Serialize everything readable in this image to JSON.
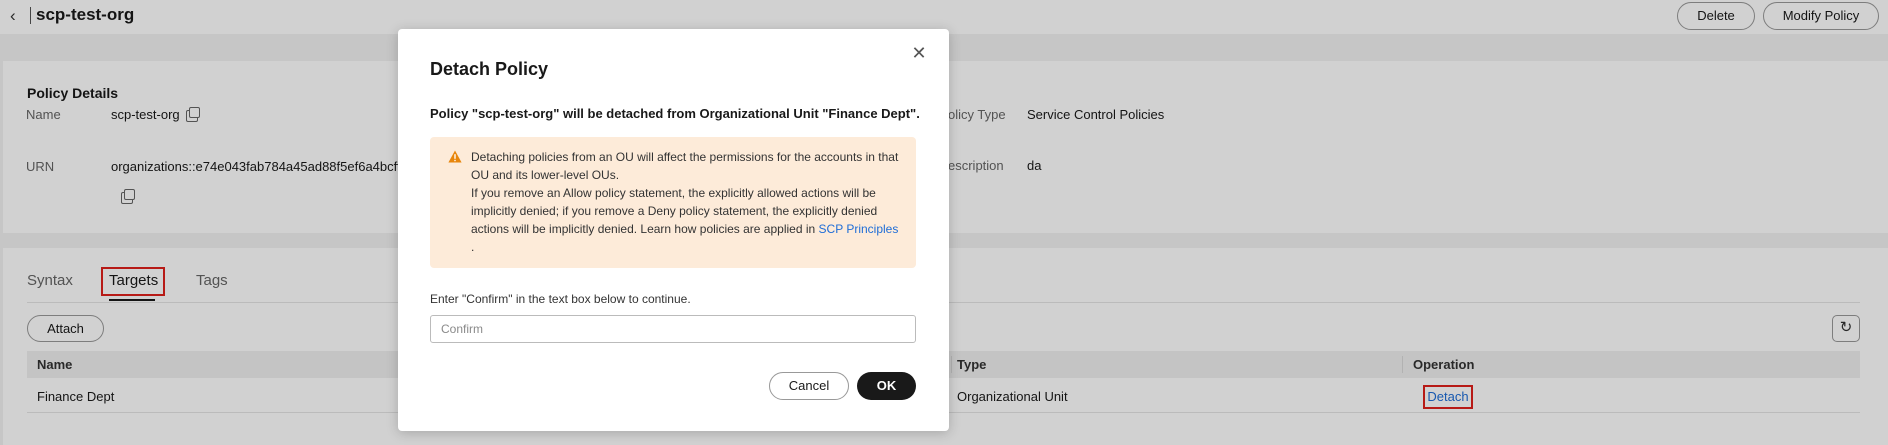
{
  "header": {
    "back_icon": "chevron-left-icon",
    "title": "scp-test-org",
    "delete_label": "Delete",
    "modify_label": "Modify Policy"
  },
  "policy_details": {
    "title": "Policy Details",
    "name_label": "Name",
    "name_value": "scp-test-org",
    "urn_label": "URN",
    "urn_value": "organizations::e74e043fab784a45ad88f5ef6a4bcffc:pc",
    "type_label": "olicy Type",
    "type_value": "Service Control Policies",
    "description_label": "escription",
    "description_value": "da"
  },
  "tabs": [
    {
      "label": "Syntax"
    },
    {
      "label": "Targets"
    },
    {
      "label": "Tags"
    }
  ],
  "targets": {
    "attach_label": "Attach",
    "refresh_icon": "refresh-icon",
    "columns": [
      "Name",
      "Type",
      "Operation"
    ],
    "rows": [
      {
        "name": "Finance Dept",
        "type": "Organizational Unit",
        "operation": "Detach"
      }
    ]
  },
  "modal": {
    "title": "Detach Policy",
    "message": "Policy \"scp-test-org\" will be detached from Organizational Unit \"Finance Dept\".",
    "warning_line1": "Detaching policies from an OU will affect the permissions for the accounts in that OU and its lower-level OUs.",
    "warning_line2_prefix": "If you remove an Allow policy statement, the explicitly allowed actions will be implicitly denied; if you remove a Deny policy statement, the explicitly denied actions will be implicitly denied. Learn how policies are applied in ",
    "warning_link": "SCP Principles",
    "warning_suffix": ".",
    "confirm_hint": "Enter \"Confirm\" in the text box below to continue.",
    "confirm_placeholder": "Confirm",
    "cancel_label": "Cancel",
    "ok_label": "OK"
  },
  "colors": {
    "warning_bg": "#fdebd9",
    "warning_icon": "#e8860c",
    "link": "#1e6dd7",
    "highlight": "#e0201c",
    "primary_button": "#191919"
  }
}
